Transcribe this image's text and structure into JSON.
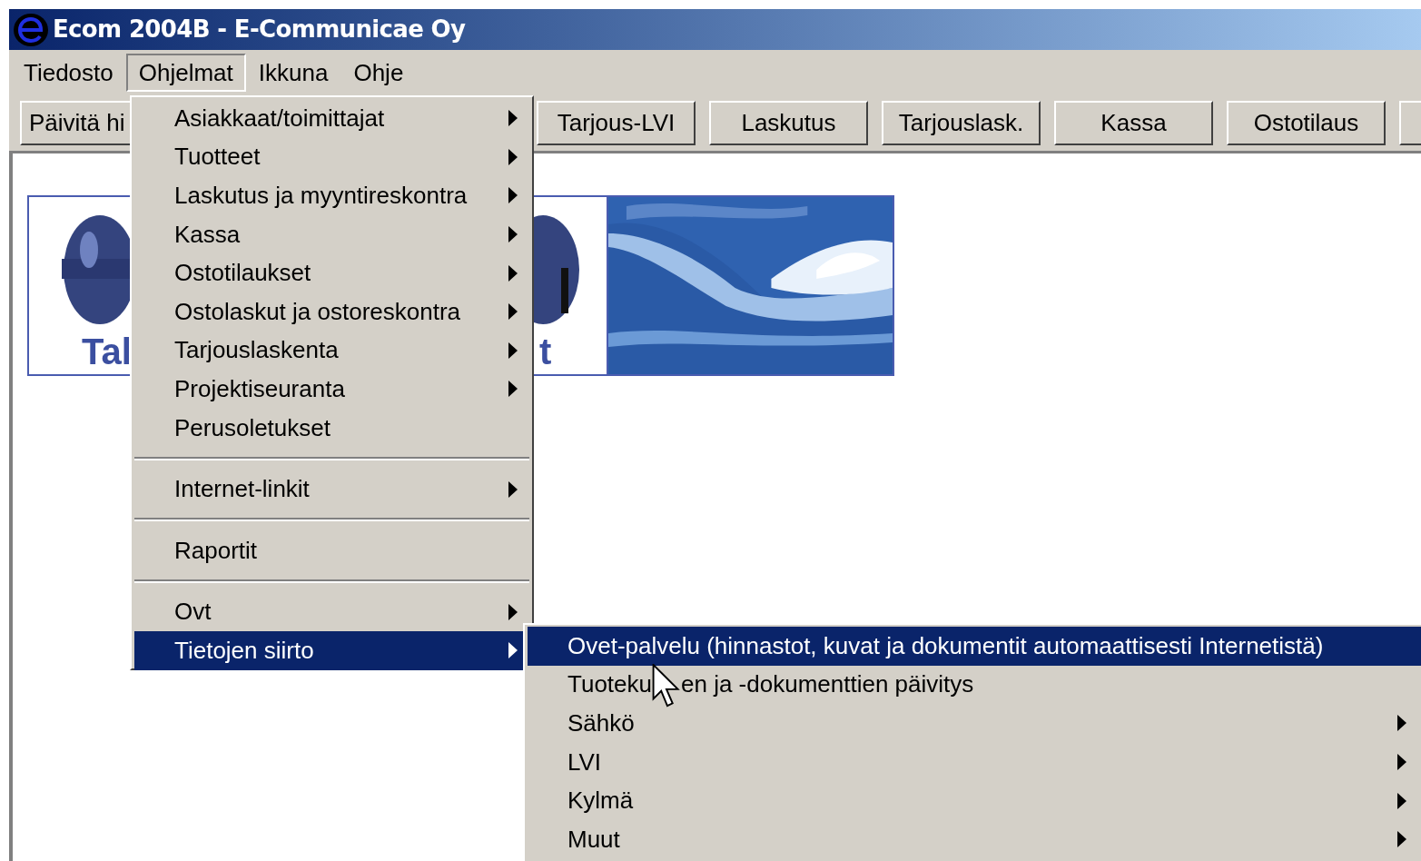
{
  "window": {
    "title": "Ecom 2004B - E-Communicae Oy"
  },
  "menubar": [
    {
      "label": "Tiedosto",
      "selected": false
    },
    {
      "label": "Ohjelmat",
      "selected": true
    },
    {
      "label": "Ikkuna",
      "selected": false
    },
    {
      "label": "Ohje",
      "selected": false
    }
  ],
  "toolbar": [
    {
      "label": "Päivitä hi"
    },
    {
      "label": "Tarjous-LVI"
    },
    {
      "label": "Laskutus"
    },
    {
      "label": "Tarjouslask."
    },
    {
      "label": "Kassa"
    },
    {
      "label": "Ostotilaus"
    }
  ],
  "logo": {
    "left_text": "Tal",
    "right_text": "t"
  },
  "menu": {
    "items": [
      {
        "kind": "item",
        "label": "Asiakkaat/toimittajat",
        "submenu": true,
        "selected": false
      },
      {
        "kind": "item",
        "label": "Tuotteet",
        "submenu": true,
        "selected": false
      },
      {
        "kind": "item",
        "label": "Laskutus ja myyntireskontra",
        "submenu": true,
        "selected": false
      },
      {
        "kind": "item",
        "label": "Kassa",
        "submenu": true,
        "selected": false
      },
      {
        "kind": "item",
        "label": "Ostotilaukset",
        "submenu": true,
        "selected": false
      },
      {
        "kind": "item",
        "label": "Ostolaskut ja ostoreskontra",
        "submenu": true,
        "selected": false
      },
      {
        "kind": "item",
        "label": "Tarjouslaskenta",
        "submenu": true,
        "selected": false
      },
      {
        "kind": "item",
        "label": "Projektiseuranta",
        "submenu": true,
        "selected": false
      },
      {
        "kind": "item",
        "label": "Perusoletukset",
        "submenu": false,
        "selected": false
      },
      {
        "kind": "separator"
      },
      {
        "kind": "item",
        "label": "Internet-linkit",
        "submenu": true,
        "selected": false
      },
      {
        "kind": "separator"
      },
      {
        "kind": "item",
        "label": "Raportit",
        "submenu": false,
        "selected": false
      },
      {
        "kind": "separator"
      },
      {
        "kind": "item",
        "label": "Ovt",
        "submenu": true,
        "selected": false
      },
      {
        "kind": "item",
        "label": "Tietojen siirto",
        "submenu": true,
        "selected": true
      }
    ]
  },
  "submenu": {
    "items": [
      {
        "label": "Ovet-palvelu (hinnastot, kuvat ja dokumentit automaattisesti Internetistä)",
        "submenu": false,
        "selected": true
      },
      {
        "label": "Tuoteku",
        "label_after_cursor": "en ja -dokumenttien päivitys",
        "submenu": false,
        "selected": false
      },
      {
        "label": "Sähkö",
        "submenu": true,
        "selected": false
      },
      {
        "label": "LVI",
        "submenu": true,
        "selected": false
      },
      {
        "label": "Kylmä",
        "submenu": true,
        "selected": false
      },
      {
        "label": "Muut",
        "submenu": true,
        "selected": false
      }
    ]
  }
}
